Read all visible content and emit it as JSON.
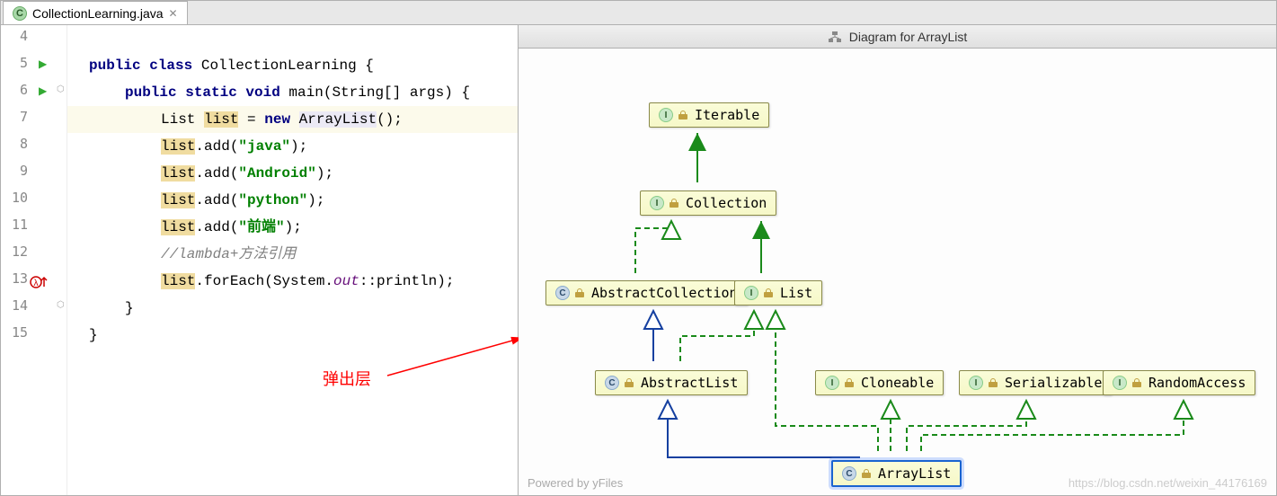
{
  "tab": {
    "filename": "CollectionLearning.java"
  },
  "lines": {
    "4": 4,
    "5": 5,
    "6": 6,
    "7": 7,
    "8": 8,
    "9": 9,
    "10": 10,
    "11": 11,
    "12": 12,
    "13": 13,
    "14": 14,
    "15": 15
  },
  "code": {
    "l5_kw1": "public",
    "l5_kw2": "class",
    "l5_name": " CollectionLearning {",
    "l6_kw1": "public static void",
    "l6_rest": " main(String[] args) {",
    "l7_a": "List ",
    "l7_b": "list",
    "l7_c": " = ",
    "l7_kw": "new",
    "l7_d": " ",
    "l7_t": "ArrayList",
    "l7_e": "();",
    "l8_a": "list",
    "l8_b": ".add(",
    "l8_s": "\"java\"",
    "l8_c": ");",
    "l9_a": "list",
    "l9_b": ".add(",
    "l9_s": "\"Android\"",
    "l9_c": ");",
    "l10_a": "list",
    "l10_b": ".add(",
    "l10_s": "\"python\"",
    "l10_c": ");",
    "l11_a": "list",
    "l11_b": ".add(",
    "l11_s": "\"前端\"",
    "l11_c": ");",
    "l12_c": "//lambda+方法引用",
    "l13_a": "list",
    "l13_b": ".forEach(System.",
    "l13_f": "out",
    "l13_c": "::println);",
    "l14": "}",
    "l15": "}"
  },
  "annotation": "弹出层",
  "diagram": {
    "title": "Diagram for ArrayList",
    "powered": "Powered by yFiles",
    "watermark": "https://blog.csdn.net/weixin_44176169",
    "nodes": {
      "iterable": "Iterable",
      "collection": "Collection",
      "abscoll": "AbstractCollection",
      "list": "List",
      "abslist": "AbstractList",
      "cloneable": "Cloneable",
      "serializable": "Serializable",
      "random": "RandomAccess",
      "arraylist": "ArrayList"
    }
  }
}
